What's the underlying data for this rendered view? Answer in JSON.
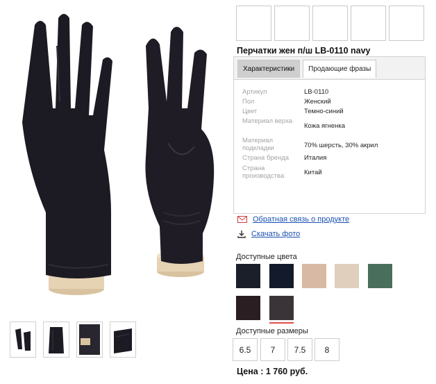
{
  "product": {
    "title": "Перчатки жен п/ш LB-0110 navy",
    "price": "Цена : 1 760 руб."
  },
  "tabs": [
    {
      "label": "Характеристики",
      "active": true
    },
    {
      "label": "Продающие фразы",
      "active": false
    }
  ],
  "specs": [
    {
      "label": "Артикул",
      "value": "LB-0110"
    },
    {
      "label": "Пол",
      "value": "Женский"
    },
    {
      "label": "Цвет",
      "value": "Темно-синий"
    },
    {
      "label": "Материал верха",
      "value": "Кожа ягненка"
    },
    {
      "label": "Материал подкладки",
      "value": "70% шерсть, 30% акрил"
    },
    {
      "label": "Страна бренда",
      "value": "Италия"
    },
    {
      "label": "Страна производства",
      "value": "Китай"
    }
  ],
  "links": {
    "feedback": "Обратная связь о продукте",
    "download": "Скачать фото"
  },
  "colors": {
    "label": "Доступные цвета",
    "swatches": [
      "#1b1f2a",
      "#131a2b",
      "#d8b9a3",
      "#e0cfbc",
      "#4a6e5c",
      "#2a1e22",
      "#3a3438"
    ],
    "selected_index": 6
  },
  "sizes": {
    "label": "Доступные размеры",
    "options": [
      "6.5",
      "7",
      "7.5",
      "8"
    ]
  },
  "accent": "#e24b4b",
  "link_color": "#1a4fb3"
}
